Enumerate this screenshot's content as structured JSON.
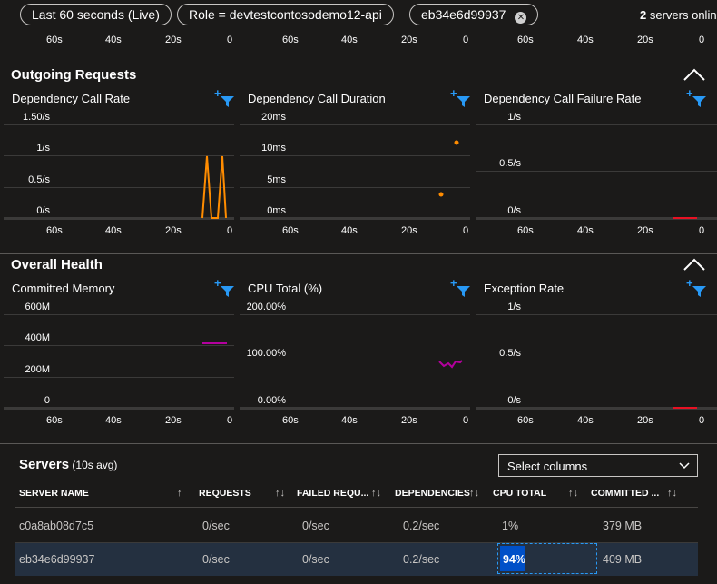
{
  "filters": {
    "time_range": "Last 60 seconds (Live)",
    "role": "Role = devtestcontosodemo12-api",
    "server": "eb34e6d99937"
  },
  "servers_online": {
    "count": "2",
    "label": "servers online"
  },
  "x_ticks": [
    "60s",
    "40s",
    "20s",
    "0"
  ],
  "outgoing": {
    "title": "Outgoing Requests",
    "charts": [
      {
        "title": "Dependency Call Rate",
        "y_ticks": [
          "1.50/s",
          "1/s",
          "0.5/s",
          "0/s"
        ]
      },
      {
        "title": "Dependency Call Duration",
        "y_ticks": [
          "20ms",
          "10ms",
          "5ms",
          "0ms"
        ]
      },
      {
        "title": "Dependency Call Failure Rate",
        "y_ticks": [
          "1/s",
          "0.5/s",
          "0/s"
        ]
      }
    ]
  },
  "health": {
    "title": "Overall Health",
    "charts": [
      {
        "title": "Committed Memory",
        "y_ticks": [
          "600M",
          "400M",
          "200M",
          "0"
        ]
      },
      {
        "title": "CPU Total (%)",
        "y_ticks": [
          "200.00%",
          "100.00%",
          "0.00%"
        ]
      },
      {
        "title": "Exception Rate",
        "y_ticks": [
          "1/s",
          "0.5/s",
          "0/s"
        ]
      }
    ]
  },
  "servers": {
    "title": "Servers",
    "subtitle": "(10s avg)",
    "select_columns": "Select columns",
    "columns": [
      "SERVER NAME",
      "REQUESTS",
      "FAILED REQU...",
      "DEPENDENCIES",
      "CPU TOTAL",
      "COMMITTED ..."
    ],
    "rows": [
      {
        "name": "c0a8ab08d7c5",
        "requests": "0/sec",
        "failed": "0/sec",
        "dependencies": "0.2/sec",
        "cpu": "1%",
        "cpu_fraction": 0.01,
        "memory": "379 MB"
      },
      {
        "name": "eb34e6d99937",
        "requests": "0/sec",
        "failed": "0/sec",
        "dependencies": "0.2/sec",
        "cpu": "94%",
        "cpu_fraction": 0.94,
        "memory": "409 MB"
      }
    ]
  },
  "colors": {
    "orange": "#ff8c00",
    "red": "#e81123",
    "magenta": "#b4009e",
    "accent_blue": "#2899f5",
    "cpu_bar": "#0050c8"
  },
  "icons": [
    "add-filter-icon",
    "chevron-up-icon",
    "chevron-down-icon",
    "close-icon",
    "sort-icon"
  ]
}
